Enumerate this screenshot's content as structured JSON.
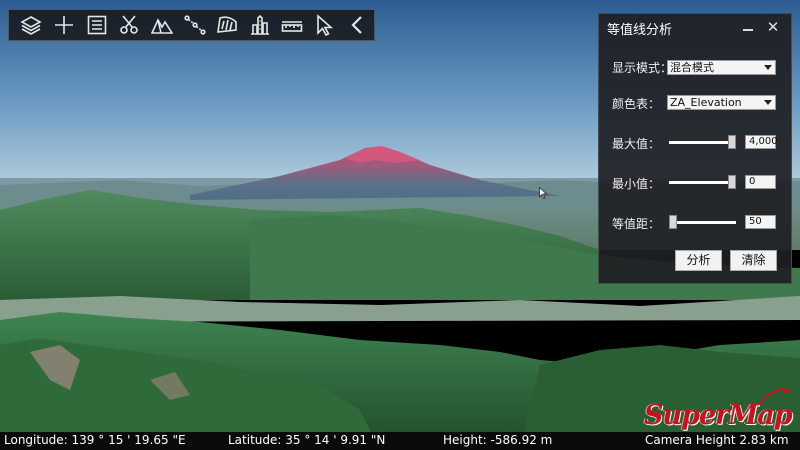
{
  "toolbar": {
    "tools": [
      {
        "name": "layers-icon"
      },
      {
        "name": "plus-icon"
      },
      {
        "name": "list-icon"
      },
      {
        "name": "scissors-icon"
      },
      {
        "name": "terrain-icon"
      },
      {
        "name": "measure-path-icon"
      },
      {
        "name": "area-icon"
      },
      {
        "name": "buildings-icon"
      },
      {
        "name": "ruler-icon"
      },
      {
        "name": "pointer-icon"
      },
      {
        "name": "collapse-chevron-icon"
      }
    ]
  },
  "panel": {
    "title": "等值线分析",
    "display_mode_label": "显示模式：",
    "display_mode_value": "混合模式",
    "color_table_label": "颜色表：",
    "color_table_value": "ZA_Elevation",
    "max_label": "最大值：",
    "max_value": "4,000",
    "max_fraction": 1.0,
    "min_label": "最小值：",
    "min_value": "0",
    "min_fraction": 1.0,
    "interval_label": "等值距：",
    "interval_value": "50",
    "interval_fraction": 0.0,
    "analyze_button": "分析",
    "clear_button": "清除"
  },
  "status": {
    "longitude": "Longitude: 139 ° 15 ' 19.65 \"E",
    "latitude": "Latitude: 35 ° 14 ' 9.91 \"N",
    "height": "Height: -586.92 m",
    "camera_height": "Camera Height  2.83 km"
  },
  "logo": {
    "text": "SuperMap",
    "color": "#c9121e"
  },
  "colors": {
    "panel_bg": "#1e2024",
    "sky_top": "#2f5f95",
    "sky_horizon": "#a9c5d9",
    "forest": "#2e6a3c"
  }
}
